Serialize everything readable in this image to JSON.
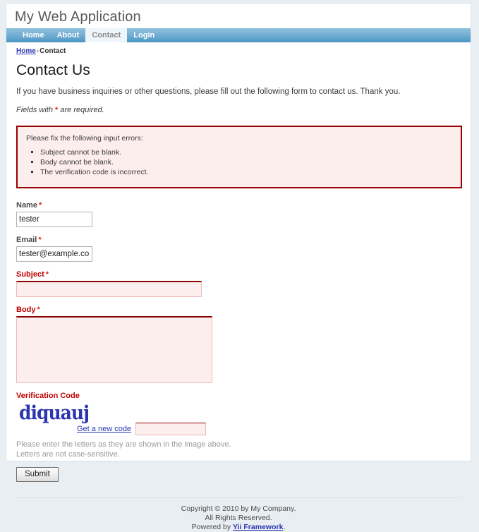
{
  "header": {
    "site_title": "My Web Application"
  },
  "nav": {
    "items": [
      {
        "label": "Home",
        "active": false
      },
      {
        "label": "About",
        "active": false
      },
      {
        "label": "Contact",
        "active": true
      },
      {
        "label": "Login",
        "active": false
      }
    ]
  },
  "breadcrumb": {
    "home": "Home",
    "separator": "›",
    "current": "Contact"
  },
  "content": {
    "page_title": "Contact Us",
    "intro": "If you have business inquiries or other questions, please fill out the following form to contact us. Thank you.",
    "note_prefix": "Fields with",
    "note_asterisk": "*",
    "note_suffix": "are required."
  },
  "error_summary": {
    "heading": "Please fix the following input errors:",
    "errors": [
      "Subject cannot be blank.",
      "Body cannot be blank.",
      "The verification code is incorrect."
    ]
  },
  "form": {
    "name": {
      "label": "Name",
      "required_mark": "*",
      "value": "tester",
      "placeholder": ""
    },
    "email": {
      "label": "Email",
      "required_mark": "*",
      "value": "tester@example.com",
      "placeholder": ""
    },
    "subject": {
      "label": "Subject",
      "required_mark": "*",
      "value": "",
      "placeholder": ""
    },
    "body": {
      "label": "Body",
      "required_mark": "*",
      "value": "",
      "placeholder": ""
    },
    "verification": {
      "label": "Verification Code",
      "captcha_text": "diquauj",
      "refresh_link": "Get a new code",
      "value": "",
      "placeholder": "",
      "hint_line1": "Please enter the letters as they are shown in the image above.",
      "hint_line2": "Letters are not case-sensitive."
    },
    "submit_label": "Submit"
  },
  "footer": {
    "line1": "Copyright © 2010 by My Company.",
    "line2": "All Rights Reserved.",
    "powered_prefix": "Powered by",
    "powered_link": "Yii Framework",
    "powered_suffix": "."
  },
  "colors": {
    "nav_blue": "#4a96c4",
    "error_border": "#9b0000",
    "error_bg": "#fdeeee",
    "link_blue": "#2b36b0",
    "required_red": "#e8201e",
    "captcha_blue": "#2b36b0"
  }
}
